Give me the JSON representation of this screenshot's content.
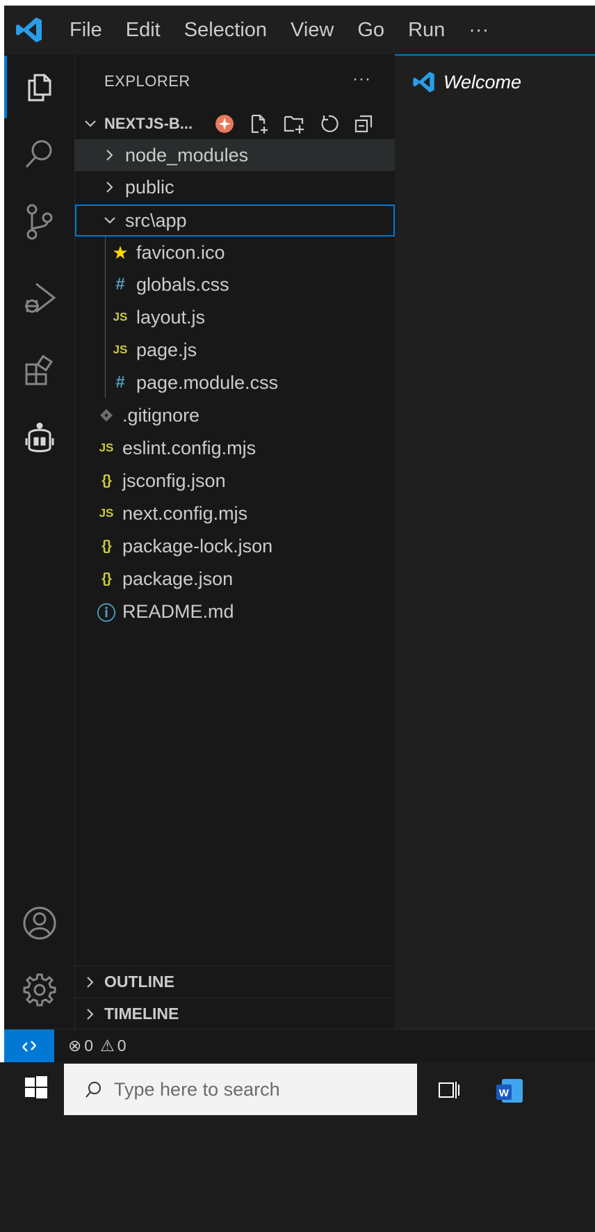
{
  "window": {
    "menu": [
      "File",
      "Edit",
      "Selection",
      "View",
      "Go",
      "Run",
      "···"
    ]
  },
  "explorer": {
    "header": "EXPLORER",
    "more": "···",
    "folder_name": "NEXTJS-B...",
    "tree": [
      {
        "label": "node_modules",
        "kind": "folder",
        "expanded": false,
        "depth": 1
      },
      {
        "label": "public",
        "kind": "folder",
        "expanded": false,
        "depth": 1
      },
      {
        "label": "src\\app",
        "kind": "folder",
        "expanded": true,
        "depth": 1
      },
      {
        "label": "favicon.ico",
        "kind": "file",
        "icon": "star-icon",
        "depth": 2
      },
      {
        "label": "globals.css",
        "kind": "file",
        "icon": "css-hash-icon",
        "depth": 2
      },
      {
        "label": "layout.js",
        "kind": "file",
        "icon": "js-icon",
        "depth": 2
      },
      {
        "label": "page.js",
        "kind": "file",
        "icon": "js-icon",
        "depth": 2
      },
      {
        "label": "page.module.css",
        "kind": "file",
        "icon": "css-hash-icon",
        "depth": 2
      },
      {
        "label": ".gitignore",
        "kind": "file",
        "icon": "git-icon",
        "depth": 1
      },
      {
        "label": "eslint.config.mjs",
        "kind": "file",
        "icon": "js-icon",
        "depth": 1
      },
      {
        "label": "jsconfig.json",
        "kind": "file",
        "icon": "json-icon",
        "depth": 1
      },
      {
        "label": "next.config.mjs",
        "kind": "file",
        "icon": "js-icon",
        "depth": 1
      },
      {
        "label": "package-lock.json",
        "kind": "file",
        "icon": "json-icon",
        "depth": 1
      },
      {
        "label": "package.json",
        "kind": "file",
        "icon": "json-icon",
        "depth": 1
      },
      {
        "label": "README.md",
        "kind": "file",
        "icon": "info-icon",
        "depth": 1
      }
    ],
    "icon_glyphs": {
      "js": "JS",
      "css": "#",
      "json": "{}",
      "info": "ⓘ",
      "star": "★"
    },
    "sections": [
      "OUTLINE",
      "TIMELINE"
    ]
  },
  "editor": {
    "tab_label": "Welcome"
  },
  "statusbar": {
    "errors": "0",
    "warnings": "0"
  },
  "taskbar": {
    "search_placeholder": "Type here to search"
  },
  "colors": {
    "accent": "#0078d4",
    "sidebar_bg": "#181818",
    "editor_bg": "#1f1f1f",
    "js_yellow": "#cbcb41",
    "css_blue": "#519aba"
  }
}
